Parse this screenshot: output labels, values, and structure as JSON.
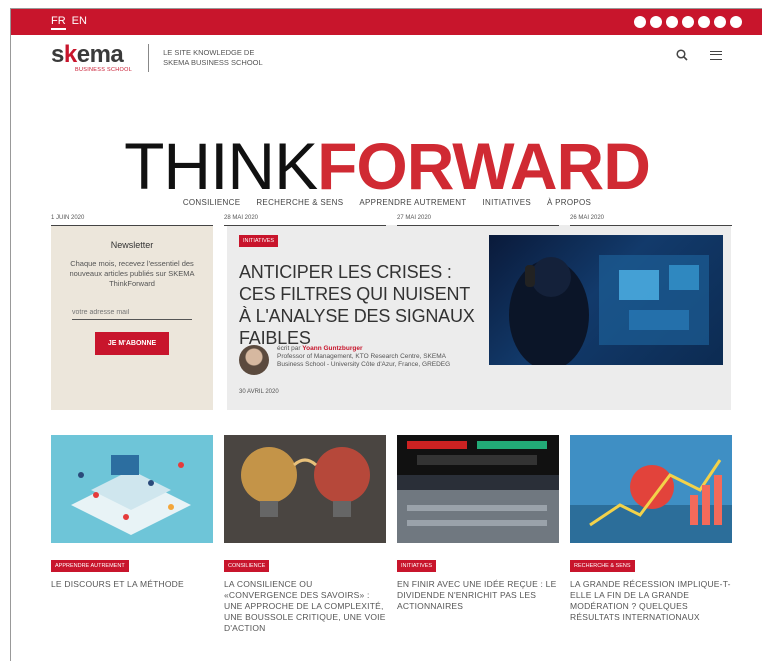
{
  "topbar": {
    "languages": [
      "FR",
      "EN"
    ],
    "social_icons": [
      "facebook-icon",
      "twitter-icon",
      "instagram-icon",
      "linkedin-icon",
      "youtube-icon",
      "podcast-icon",
      "rss-icon"
    ]
  },
  "header": {
    "logo_text_1": "s",
    "logo_text_k": "k",
    "logo_text_2": "ema",
    "logo_sub": "BUSINESS SCHOOL",
    "tagline_1": "LE SITE KNOWLEDGE DE",
    "tagline_2": "SKEMA BUSINESS SCHOOL",
    "search_icon": "search-icon",
    "menu_icon": "menu-icon"
  },
  "brand": {
    "part1": "THINK",
    "part2": "FORWARD"
  },
  "nav": [
    "CONSILIENCE",
    "RECHERCHE & SENS",
    "APPRENDRE AUTREMENT",
    "INITIATIVES",
    "À PROPOS"
  ],
  "newsletter": {
    "title": "Newsletter",
    "text": "Chaque mois, recevez l'essentiel des nouveaux articles publiés sur SKEMA ThinkForward",
    "placeholder": "votre adresse mail",
    "button": "JE M'ABONNE"
  },
  "featured": {
    "tag": "INITIATIVES",
    "title": "ANTICIPER LES CRISES : CES FILTRES QUI NUISENT À L'ANALYSE DES SIGNAUX FAIBLES",
    "author_prefix": "écrit par",
    "author_name": "Yoann Guntzburger",
    "author_bio": "Professor of Management, KTO Research Centre, SKEMA Business School - University Côte d'Azur, France, GREDEG",
    "date": "30 AVRIL 2020"
  },
  "cards": [
    {
      "tag": "APPRENDRE AUTREMENT",
      "title": "LE DISCOURS ET LA MÉTHODE",
      "date": "1 JUIN 2020"
    },
    {
      "tag": "CONSILIENCE",
      "title": "LA CONSILIENCE OU «CONVERGENCE DES SAVOIRS» : UNE APPROCHE DE LA COMPLEXITÉ, UNE BOUSSOLE CRITIQUE, UNE VOIE D'ACTION",
      "date": "28 MAI 2020"
    },
    {
      "tag": "INITIATIVES",
      "title": "EN FINIR AVEC UNE IDÉE REÇUE : LE DIVIDENDE N'ENRICHIT PAS LES ACTIONNAIRES",
      "date": "27 MAI 2020"
    },
    {
      "tag": "RECHERCHE & SENS",
      "title": "LA GRANDE RÉCESSION IMPLIQUE-T-ELLE LA FIN DE LA GRANDE MODÉRATION ? QUELQUES RÉSULTATS INTERNATIONAUX",
      "date": "26 MAI 2020"
    }
  ],
  "colors": {
    "brand_red": "#c8152c",
    "newsletter_bg": "#ece6db",
    "featured_bg": "#ececec"
  }
}
